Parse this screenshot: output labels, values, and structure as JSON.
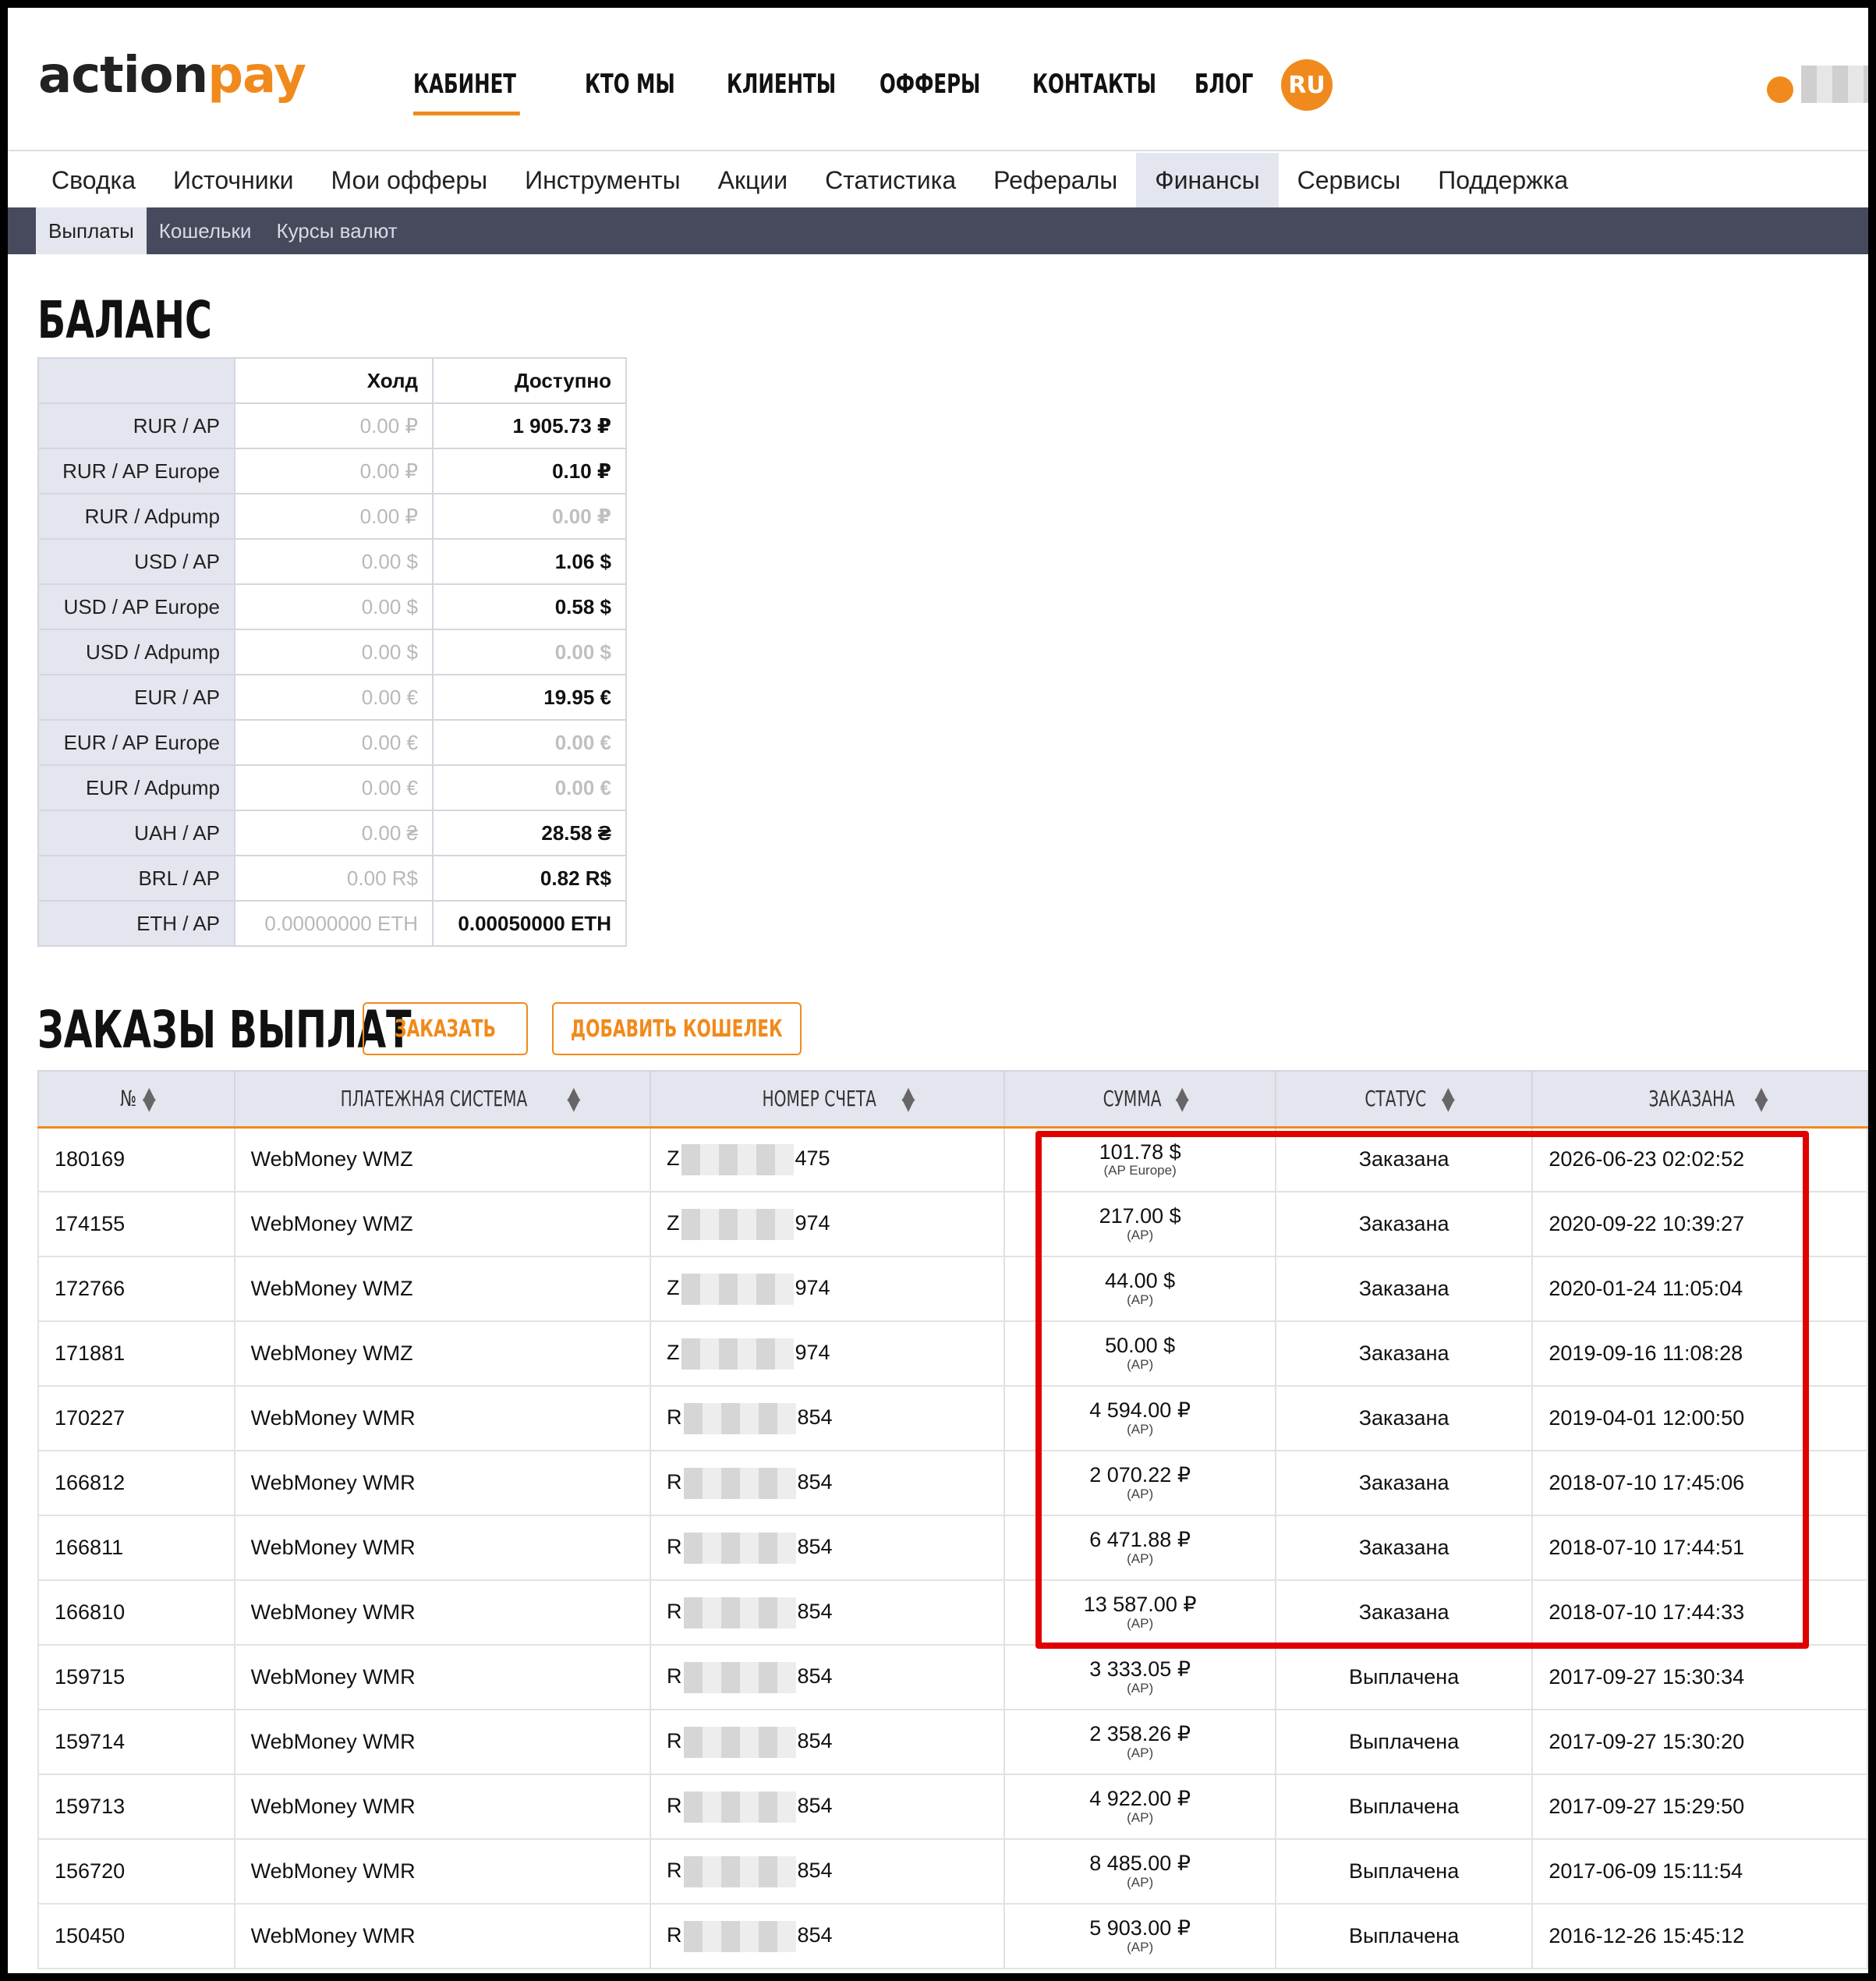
{
  "logo": {
    "part1": "action",
    "part2": "pay"
  },
  "topnav": [
    "КАБИНЕТ",
    "КТО МЫ",
    "КЛИЕНТЫ",
    "ОФФЕРЫ",
    "КОНТАКТЫ",
    "БЛОГ"
  ],
  "lang": "RU",
  "mainnav": [
    "Сводка",
    "Источники",
    "Мои офферы",
    "Инструменты",
    "Акции",
    "Статистика",
    "Рефералы",
    "Финансы",
    "Сервисы",
    "Поддержка"
  ],
  "subnav": [
    "Выплаты",
    "Кошельки",
    "Курсы валют"
  ],
  "balance": {
    "title": "БАЛАНС",
    "col_hold": "Холд",
    "col_avail": "Доступно",
    "rows": [
      {
        "label": "RUR / AP",
        "hold": "0.00 ₽",
        "avail": "1 905.73 ₽"
      },
      {
        "label": "RUR / AP Europe",
        "hold": "0.00 ₽",
        "avail": "0.10 ₽"
      },
      {
        "label": "RUR / Adpump",
        "hold": "0.00 ₽",
        "avail": "0.00 ₽"
      },
      {
        "label": "USD / AP",
        "hold": "0.00 $",
        "avail": "1.06 $"
      },
      {
        "label": "USD / AP Europe",
        "hold": "0.00 $",
        "avail": "0.58 $"
      },
      {
        "label": "USD / Adpump",
        "hold": "0.00 $",
        "avail": "0.00 $"
      },
      {
        "label": "EUR / AP",
        "hold": "0.00 €",
        "avail": "19.95 €"
      },
      {
        "label": "EUR / AP Europe",
        "hold": "0.00 €",
        "avail": "0.00 €"
      },
      {
        "label": "EUR / Adpump",
        "hold": "0.00 €",
        "avail": "0.00 €"
      },
      {
        "label": "UAH / AP",
        "hold": "0.00 ₴",
        "avail": "28.58 ₴"
      },
      {
        "label": "BRL / AP",
        "hold": "0.00 R$",
        "avail": "0.82 R$"
      },
      {
        "label": "ETH / AP",
        "hold": "0.00000000 ETH",
        "avail": "0.00050000 ETH"
      }
    ]
  },
  "orders": {
    "title": "ЗАКАЗЫ ВЫПЛАТ",
    "order_button": "ЗАКАЗАТЬ",
    "add_wallet_button": "ДОБАВИТЬ КОШЕЛЕК",
    "columns": [
      "№",
      "ПЛАТЕЖНАЯ СИСТЕМА",
      "НОМЕР СЧЕТА",
      "СУММА",
      "СТАТУС",
      "ЗАКАЗАНА"
    ],
    "rows": [
      {
        "id": "180169",
        "system": "WebMoney WMZ",
        "acc_prefix": "Z",
        "acc_suffix": "475",
        "amount": "101.78 $",
        "source": "(AP Europe)",
        "status": "Заказана",
        "date": "2026-06-23 02:02:52"
      },
      {
        "id": "174155",
        "system": "WebMoney WMZ",
        "acc_prefix": "Z",
        "acc_suffix": "974",
        "amount": "217.00 $",
        "source": "(AP)",
        "status": "Заказана",
        "date": "2020-09-22 10:39:27"
      },
      {
        "id": "172766",
        "system": "WebMoney WMZ",
        "acc_prefix": "Z",
        "acc_suffix": "974",
        "amount": "44.00 $",
        "source": "(AP)",
        "status": "Заказана",
        "date": "2020-01-24 11:05:04"
      },
      {
        "id": "171881",
        "system": "WebMoney WMZ",
        "acc_prefix": "Z",
        "acc_suffix": "974",
        "amount": "50.00 $",
        "source": "(AP)",
        "status": "Заказана",
        "date": "2019-09-16 11:08:28"
      },
      {
        "id": "170227",
        "system": "WebMoney WMR",
        "acc_prefix": "R",
        "acc_suffix": "854",
        "amount": "4 594.00 ₽",
        "source": "(AP)",
        "status": "Заказана",
        "date": "2019-04-01 12:00:50"
      },
      {
        "id": "166812",
        "system": "WebMoney WMR",
        "acc_prefix": "R",
        "acc_suffix": "854",
        "amount": "2 070.22 ₽",
        "source": "(AP)",
        "status": "Заказана",
        "date": "2018-07-10 17:45:06"
      },
      {
        "id": "166811",
        "system": "WebMoney WMR",
        "acc_prefix": "R",
        "acc_suffix": "854",
        "amount": "6 471.88 ₽",
        "source": "(AP)",
        "status": "Заказана",
        "date": "2018-07-10 17:44:51"
      },
      {
        "id": "166810",
        "system": "WebMoney WMR",
        "acc_prefix": "R",
        "acc_suffix": "854",
        "amount": "13 587.00 ₽",
        "source": "(AP)",
        "status": "Заказана",
        "date": "2018-07-10 17:44:33"
      },
      {
        "id": "159715",
        "system": "WebMoney WMR",
        "acc_prefix": "R",
        "acc_suffix": "854",
        "amount": "3 333.05 ₽",
        "source": "(AP)",
        "status": "Выплачена",
        "date": "2017-09-27 15:30:34"
      },
      {
        "id": "159714",
        "system": "WebMoney WMR",
        "acc_prefix": "R",
        "acc_suffix": "854",
        "amount": "2 358.26 ₽",
        "source": "(AP)",
        "status": "Выплачена",
        "date": "2017-09-27 15:30:20"
      },
      {
        "id": "159713",
        "system": "WebMoney WMR",
        "acc_prefix": "R",
        "acc_suffix": "854",
        "amount": "4 922.00 ₽",
        "source": "(AP)",
        "status": "Выплачена",
        "date": "2017-09-27 15:29:50"
      },
      {
        "id": "156720",
        "system": "WebMoney WMR",
        "acc_prefix": "R",
        "acc_suffix": "854",
        "amount": "8 485.00 ₽",
        "source": "(AP)",
        "status": "Выплачена",
        "date": "2017-06-09 15:11:54"
      },
      {
        "id": "150450",
        "system": "WebMoney WMR",
        "acc_prefix": "R",
        "acc_suffix": "854",
        "amount": "5 903.00 ₽",
        "source": "(AP)",
        "status": "Выплачена",
        "date": "2016-12-26 15:45:12"
      }
    ]
  },
  "colors": {
    "accent": "#f08a1c",
    "highlight": "#e00000",
    "subnav_bg": "#474a5d"
  }
}
